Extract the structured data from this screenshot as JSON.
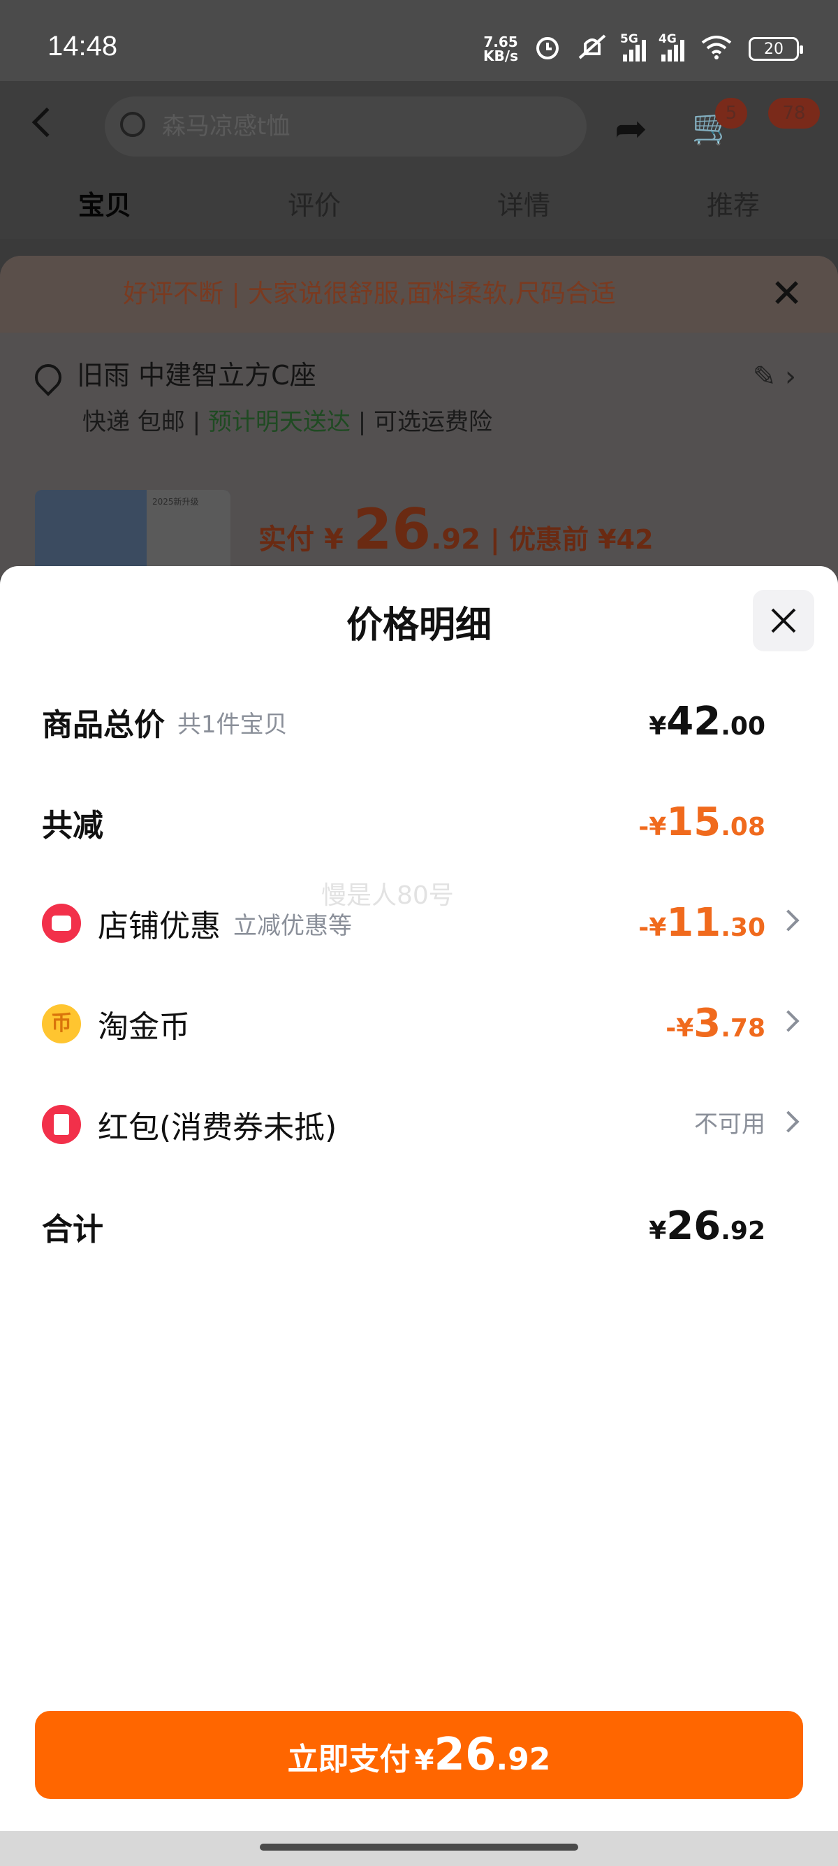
{
  "status_bar": {
    "time": "14:48",
    "net_speed_value": "7.65",
    "net_speed_unit": "KB/s",
    "sig1": "5G",
    "sig2": "4G",
    "battery": "20"
  },
  "background": {
    "search_placeholder": "森马凉感t恤",
    "cart_badge": "5",
    "more_badge": "78",
    "tabs": [
      "宝贝",
      "评价",
      "详情",
      "推荐"
    ],
    "banner": "好评不断 | 大家说很舒服,面料柔软,尺码合适",
    "address_line": "旧雨 中建智立方C座",
    "shipping": "快递 包邮",
    "delivery": "预计明天送达",
    "insurance": "可选运费险",
    "thumb_label": "2025新升级",
    "paid_label": "实付",
    "paid_yen": "¥",
    "paid_int": "26",
    "paid_dec": ".92",
    "before_label": "| 优惠前 ¥42"
  },
  "sheet": {
    "title": "价格明细",
    "rows": [
      {
        "label": "商品总价",
        "sub": "共1件宝贝",
        "yen": "¥",
        "int": "42",
        "dec": ".00"
      },
      {
        "label": "共减",
        "sub": "",
        "yen": "-¥",
        "int": "15",
        "dec": ".08"
      },
      {
        "label": "店铺优惠",
        "sub": "立减优惠等",
        "yen": "-¥",
        "int": "11",
        "dec": ".30"
      },
      {
        "label": "淘金币",
        "sub": "",
        "yen": "-¥",
        "int": "3",
        "dec": ".78"
      },
      {
        "label": "红包(消费券未抵)",
        "sub": "",
        "value": "不可用"
      },
      {
        "label": "合计",
        "sub": "",
        "yen": "¥",
        "int": "26",
        "dec": ".92"
      }
    ],
    "coin_glyph": "币",
    "watermark": "慢是人80号",
    "pay_button": {
      "label": "立即支付",
      "yen": "¥",
      "int": "26",
      "dec": ".92"
    }
  },
  "colors": {
    "accent_orange": "#ff6600",
    "discount_orange": "#f06a1d",
    "secondary_text": "#8a8f99"
  }
}
